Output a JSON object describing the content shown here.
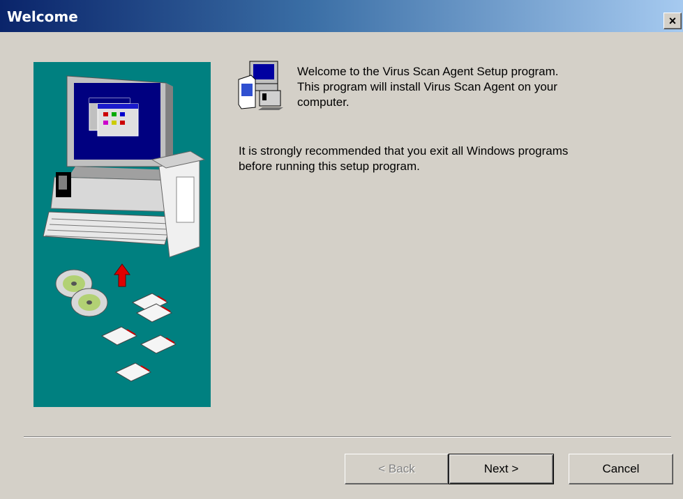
{
  "window": {
    "title": "Welcome",
    "close_label": "×"
  },
  "main": {
    "welcome_lines": [
      "Welcome to the Virus Scan Agent Setup program.",
      "This program will install Virus Scan Agent on your",
      "computer."
    ],
    "warning_lines": [
      "It is strongly recommended that you exit all Windows programs",
      "before running this setup program."
    ],
    "setup_icon": "setup-computer-icon",
    "illustration": "computer-install-illustration"
  },
  "buttons": {
    "back": "< Back",
    "next": "Next >",
    "cancel": "Cancel"
  },
  "colors": {
    "titlebar_start": "#0a246a",
    "titlebar_end": "#a6caf0",
    "dialog_bg": "#d4d0c8",
    "illustration_bg": "#008080"
  }
}
